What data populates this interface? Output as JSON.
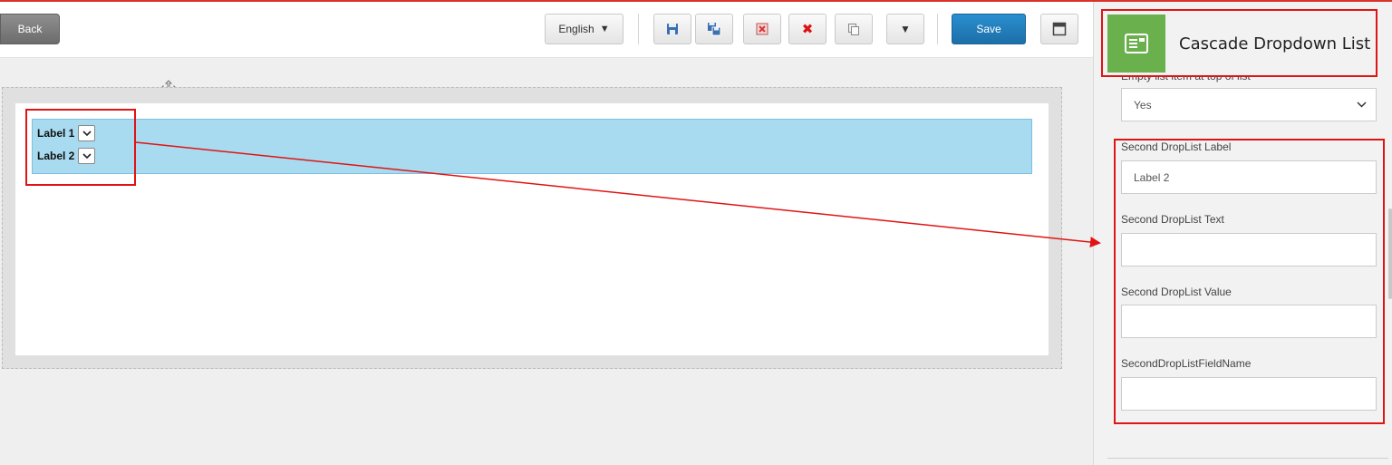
{
  "toolbar": {
    "back_label": "Back",
    "language": {
      "selected": "English",
      "caret": "▼"
    },
    "icon_buttons": [
      {
        "name": "save-icon",
        "glyph": "save",
        "color": "#3a6fb0"
      },
      {
        "name": "save-as-icon",
        "glyph": "save-as",
        "color": "#3a6fb0"
      },
      {
        "name": "discard-icon",
        "glyph": "discard",
        "color": "#d33"
      },
      {
        "name": "delete-icon",
        "glyph": "✖",
        "color": "#d11"
      },
      {
        "name": "copy-icon",
        "glyph": "copy",
        "color": "#888"
      },
      {
        "name": "more-icon",
        "glyph": "▼",
        "color": "#444"
      }
    ],
    "save_label": "Save",
    "layout_icon": "layout-icon"
  },
  "canvas": {
    "move_handle_icon": "move-icon",
    "widget": {
      "rows": [
        {
          "label": "Label 1",
          "select_glyph": "⌄"
        },
        {
          "label": "Label 2",
          "select_glyph": "⌄"
        }
      ]
    }
  },
  "panel": {
    "title": "Cascade Dropdown List",
    "tile_icon": "form-list-icon",
    "tile_color": "#6ab04c",
    "clipped_label": "Empty list item at top of list",
    "empty_item": {
      "value": "Yes"
    },
    "fields": [
      {
        "label": "Second DropList Label",
        "value": "Label 2"
      },
      {
        "label": "Second DropList Text",
        "value": ""
      },
      {
        "label": "Second DropList Value",
        "value": ""
      },
      {
        "label": "SecondDropListFieldName",
        "value": ""
      }
    ]
  },
  "annotation": {
    "color": "#e01414"
  }
}
